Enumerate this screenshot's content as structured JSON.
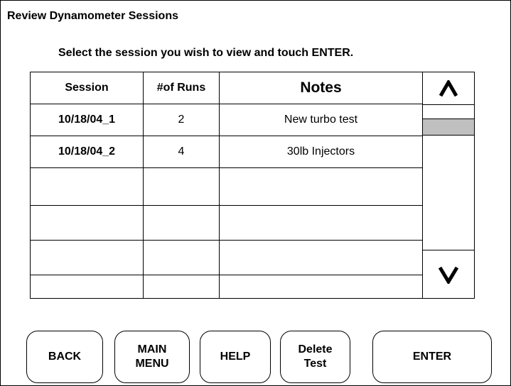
{
  "window": {
    "title": "Review Dynamometer Sessions"
  },
  "instruction": "Select  the session you wish to view and touch ENTER.",
  "table": {
    "headers": {
      "session": "Session",
      "runs": "#of Runs",
      "notes": "Notes"
    },
    "rows": [
      {
        "session": "10/18/04_1",
        "runs": "2",
        "notes": "New turbo test"
      },
      {
        "session": "10/18/04_2",
        "runs": "4",
        "notes": "30lb Injectors"
      },
      {
        "session": "",
        "runs": "",
        "notes": ""
      },
      {
        "session": "",
        "runs": "",
        "notes": ""
      },
      {
        "session": "",
        "runs": "",
        "notes": ""
      },
      {
        "session": "",
        "runs": "",
        "notes": ""
      }
    ]
  },
  "scrollbar": {
    "thumb_color": "#c0c0c0"
  },
  "buttons": {
    "back": "BACK",
    "main_menu_line1": "MAIN",
    "main_menu_line2": "MENU",
    "help": "HELP",
    "delete_line1": "Delete",
    "delete_line2": "Test",
    "enter": "ENTER"
  }
}
